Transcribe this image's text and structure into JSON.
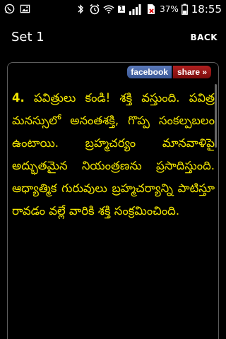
{
  "status_bar": {
    "icons": [
      "whatsapp-icon",
      "gallery-icon",
      "bluetooth-icon",
      "alarm-icon",
      "wifi-icon",
      "sim-icon",
      "signal-icon",
      "no-sim-icon"
    ],
    "sim_number": "1",
    "battery_percent": "37%",
    "time": "18:55"
  },
  "app_bar": {
    "title": "Set 1",
    "back_label": "BACK"
  },
  "share": {
    "facebook_label": "facebook",
    "share_label": "share »"
  },
  "content": {
    "verse_number": "4.",
    "verse_text": " పవిత్రులు కండి! శక్తి వస్తుంది. పవిత్ర మనస్సులో అనంతశక్తి, గొప్ప సంకల్పబలం ఉంటాయి. బ్రహ్మచర్యం మానవాళిపై అద్భుతమైన నియంత్రణను ప్రసాదిస్తుంది. ఆధ్యాత్మిక గురువులు బ్రహ్మచర్యాన్ని పాటిస్తూ రావడం వల్లే వారికి శక్తి సంక్రమించింది."
  },
  "colors": {
    "verse_text": "#f2e600",
    "facebook_bg": "#3b5998",
    "share_bg": "#8b1010"
  }
}
